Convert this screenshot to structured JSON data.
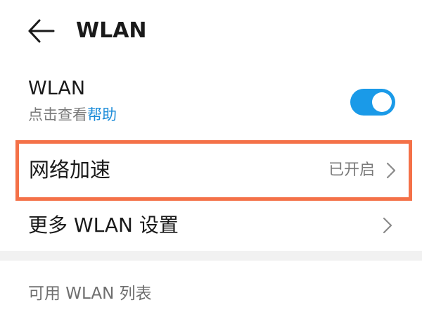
{
  "header": {
    "title": "WLAN",
    "back_icon": "arrow-left-icon"
  },
  "wlan": {
    "label": "WLAN",
    "subtitle_prefix": "点击查看",
    "help_link": "帮助",
    "toggle_state": "on",
    "accent_color": "#1a9ae8"
  },
  "network_acceleration": {
    "label": "网络加速",
    "value": "已开启",
    "highlight_color": "#f47148",
    "chevron_icon": "chevron-right-icon"
  },
  "more_settings": {
    "label": "更多 WLAN 设置",
    "chevron_icon": "chevron-right-icon"
  },
  "available_list": {
    "header": "可用 WLAN 列表"
  }
}
